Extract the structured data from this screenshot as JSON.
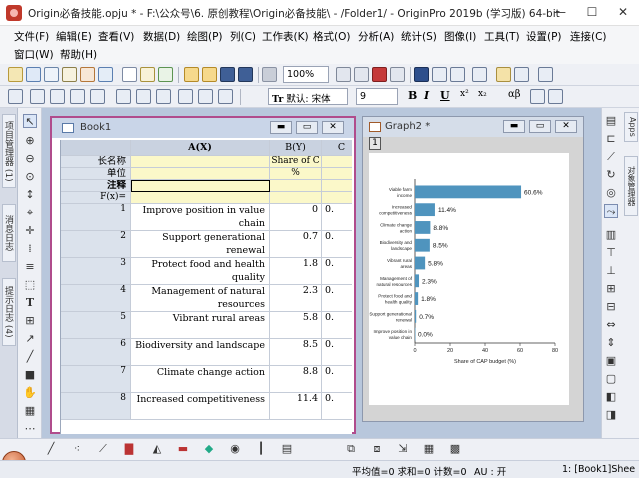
{
  "window": {
    "title": "Origin必备技能.opju * - F:\\公众号\\6. 原创教程\\Origin必备技能\\ - /Folder1/ - OriginPro 2019b (学习版) 64-bit",
    "minimize": "—",
    "maximize": "☐",
    "close": "✕"
  },
  "menu": {
    "row1": [
      "文件(F)",
      "编辑(E)",
      "查看(V)",
      "数据(D)",
      "绘图(P)",
      "列(C)",
      "工作表(K)",
      "格式(O)",
      "分析(A)",
      "统计(S)",
      "图像(I)",
      "工具(T)",
      "设置(P)",
      "连接(C)"
    ],
    "row2": [
      "窗口(W)",
      "帮助(H)"
    ]
  },
  "toolbar": {
    "zoom": "100%",
    "font_prefix": "Tr",
    "font": "默认: 宋体",
    "font_size": "9",
    "bold": "B",
    "italic": "I",
    "underline": "U",
    "superscript": "x²",
    "subscript": "x₂",
    "greek": "αβ"
  },
  "left_dock": {
    "tabs": [
      "项目管理器 (1)",
      "消息日志",
      "提示日志 (4)"
    ]
  },
  "right_dock": {
    "tabs": [
      "Apps",
      "对象管理器"
    ]
  },
  "book": {
    "title": "Book1",
    "columns": [
      {
        "header": "A(X)"
      },
      {
        "header": "B(Y)"
      },
      {
        "header": "C"
      }
    ],
    "meta": {
      "long_name_label": "长名称",
      "unit_label": "单位",
      "comment_label": "注释",
      "fx_label": "F(x)=",
      "b_long_name": "Share of C",
      "b_unit": "%"
    },
    "rows": [
      {
        "n": "1",
        "a": "Improve position in value chain",
        "b": "0",
        "c": "0."
      },
      {
        "n": "2",
        "a": "Support generational renewal",
        "b": "0.7",
        "c": "0."
      },
      {
        "n": "3",
        "a": "Protect food and health quality",
        "b": "1.8",
        "c": "0."
      },
      {
        "n": "4",
        "a": "Management of natural resources",
        "b": "2.3",
        "c": "0."
      },
      {
        "n": "5",
        "a": "Vibrant rural areas",
        "b": "5.8",
        "c": "0."
      },
      {
        "n": "6",
        "a": "Biodiversity and landscape",
        "b": "8.5",
        "c": "0."
      },
      {
        "n": "7",
        "a": "Climate change action",
        "b": "8.8",
        "c": "0."
      },
      {
        "n": "8",
        "a": "Increased competitiveness",
        "b": "11.4",
        "c": "0."
      }
    ]
  },
  "graph": {
    "title": "Graph2 *",
    "layer": "1"
  },
  "chart_data": {
    "type": "bar",
    "orientation": "horizontal",
    "categories": [
      "Viable farm income",
      "Increased competitiveness",
      "Climate change action",
      "Biodiversity and landscape",
      "Vibrant rural areas",
      "Management of natural resources",
      "Protect food and health quality",
      "Support generational renewal",
      "Improve position in value chain"
    ],
    "category_labels": [
      "Viable farm|income",
      "Increased|competitiveness",
      "Climate change|action",
      "Biodiversity and|landscape",
      "Vibrant rural|areas",
      "Management of|natural resources",
      "Protect food and|health quality",
      "Support generational|renewal",
      "Improve position in|value chain"
    ],
    "values": [
      60.6,
      11.4,
      8.8,
      8.5,
      5.8,
      2.3,
      1.8,
      0.7,
      0.0
    ],
    "value_labels": [
      "60.6%",
      "11.4%",
      "8.8%",
      "8.5%",
      "5.8%",
      "2.3%",
      "1.8%",
      "0.7%",
      "0.0%"
    ],
    "xlabel": "Share of CAP budget (%)",
    "xlim": [
      0,
      80
    ],
    "xticks": [
      "0",
      "20",
      "40",
      "60",
      "80"
    ],
    "bar_color": "#4f94be",
    "grid": false
  },
  "status": {
    "stats": "平均值=0 求和=0 计数=0",
    "au": "AU : 开",
    "sheet": "1: [Book1]Shee"
  },
  "colors": {
    "active_border": "#b04c8c",
    "workspace": "#b8c7dc",
    "comment_cell": "#fbf8c9"
  }
}
